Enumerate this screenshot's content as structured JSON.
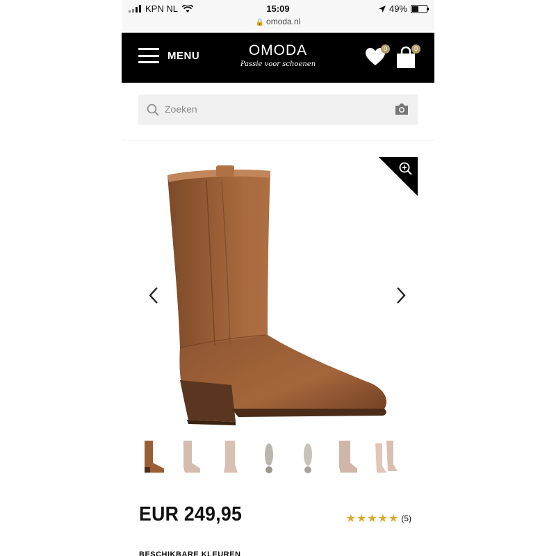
{
  "status_bar": {
    "carrier": "KPN NL",
    "time": "15:09",
    "battery": "49%",
    "battery_level": 0.49,
    "url": "omoda.nl"
  },
  "header": {
    "menu_label": "MENU",
    "logo_name": "OMODA",
    "logo_tagline": "Passie voor schoenen",
    "wishlist_count": "0",
    "cart_count": "0"
  },
  "search": {
    "placeholder": "Zoeken"
  },
  "product": {
    "price": "EUR 249,95",
    "rating_stars": "★★★★★",
    "rating_value": 5,
    "review_count": "(5)",
    "thumbnails": [
      "boot-side-brown",
      "boot-side-beige",
      "boot-front-beige",
      "boot-sole",
      "boot-sole-2",
      "boot-back-beige",
      "boot-pair-beige"
    ],
    "section_title": "BESCHIKBARE KLEUREN"
  },
  "colors": {
    "header_bg": "#000000",
    "badge": "#b8a06a",
    "star": "#d8a82e",
    "boot_leather": "#a2633a"
  }
}
